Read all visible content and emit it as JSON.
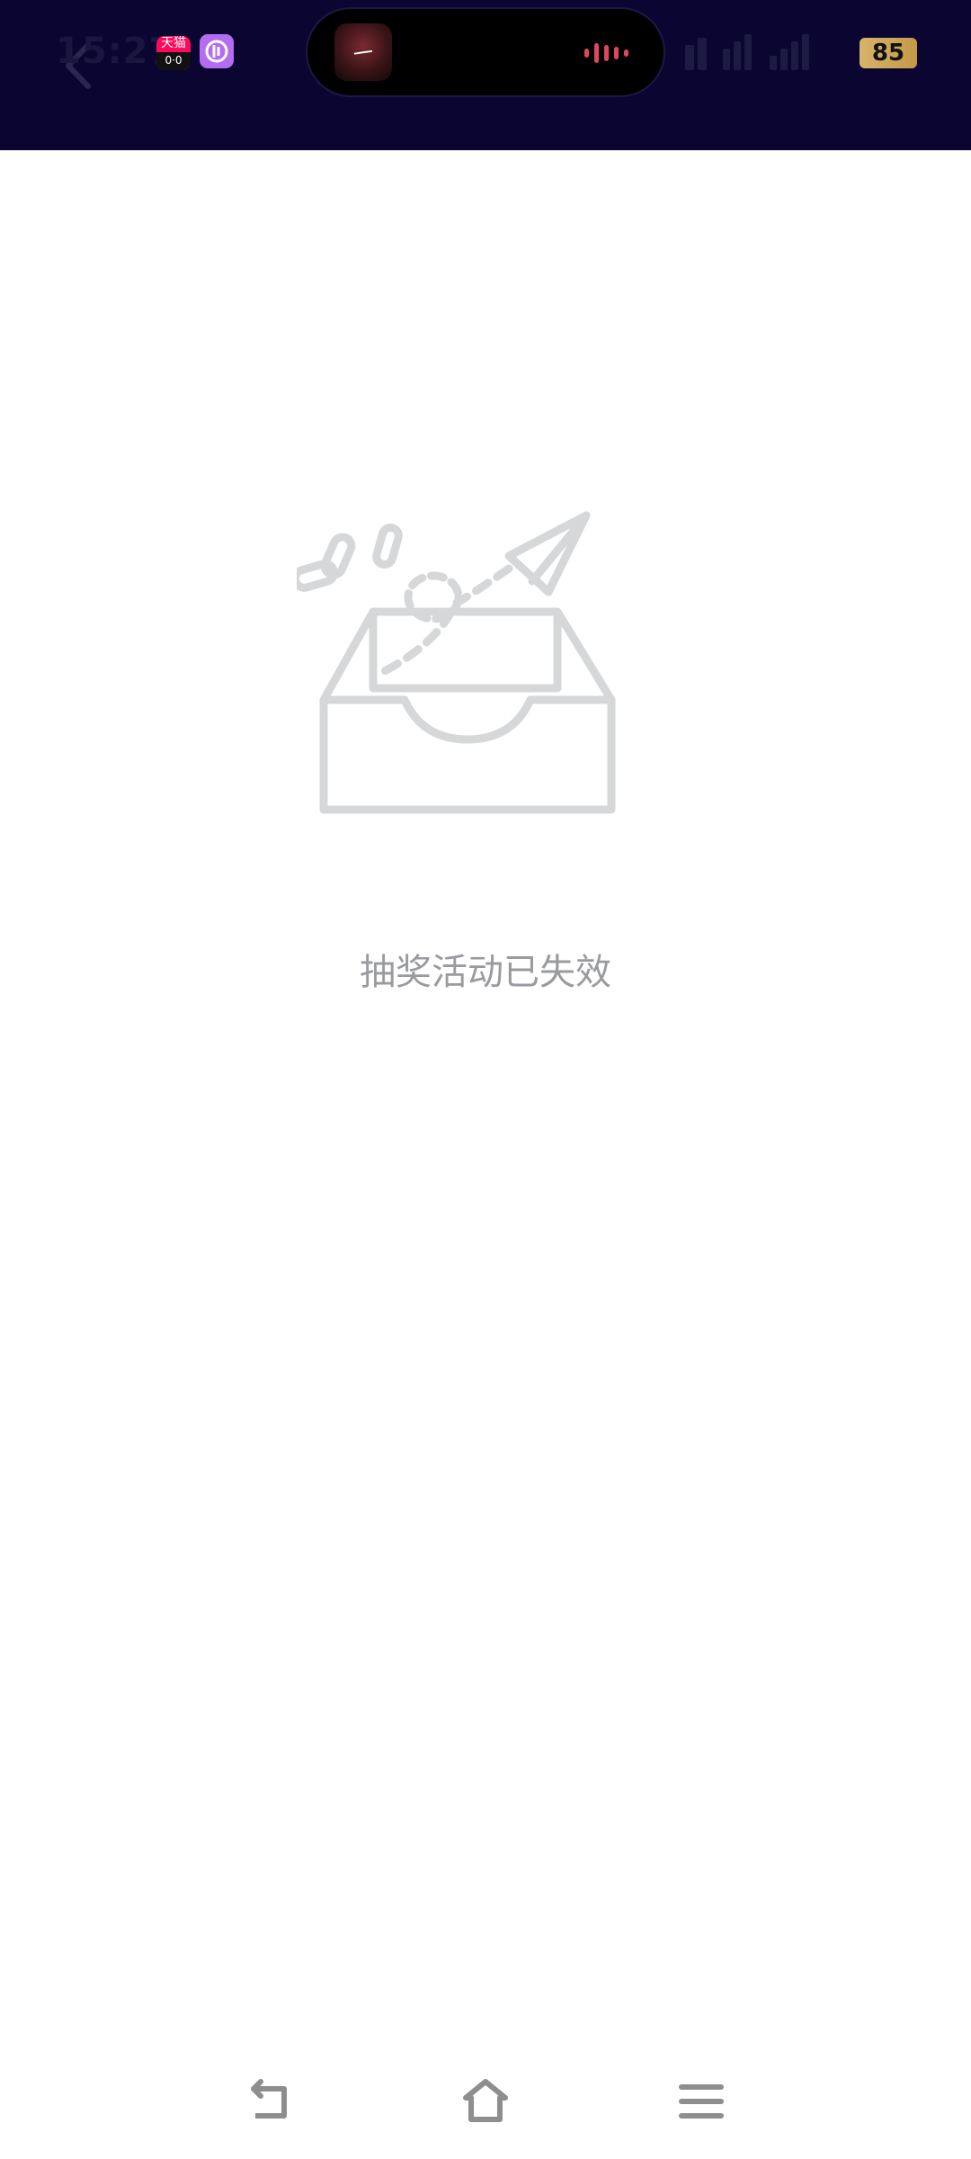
{
  "status_bar": {
    "time": "15:27",
    "battery": "85",
    "notif_app_label": "天猫",
    "notif_app_eyes": "0·0"
  },
  "header": {
    "back_icon": "chevron-left-icon",
    "background": "#0b0631"
  },
  "empty_state": {
    "illustration": "empty-inbox-paper-plane",
    "message": "抽奖活动已失效"
  },
  "nav_bar": {
    "buttons": [
      "back-icon",
      "home-icon",
      "menu-icon"
    ]
  },
  "colors": {
    "illustration_stroke": "#d5d7d8",
    "message_text": "#9a9ba0",
    "nav_icon": "#8e8e8e"
  }
}
